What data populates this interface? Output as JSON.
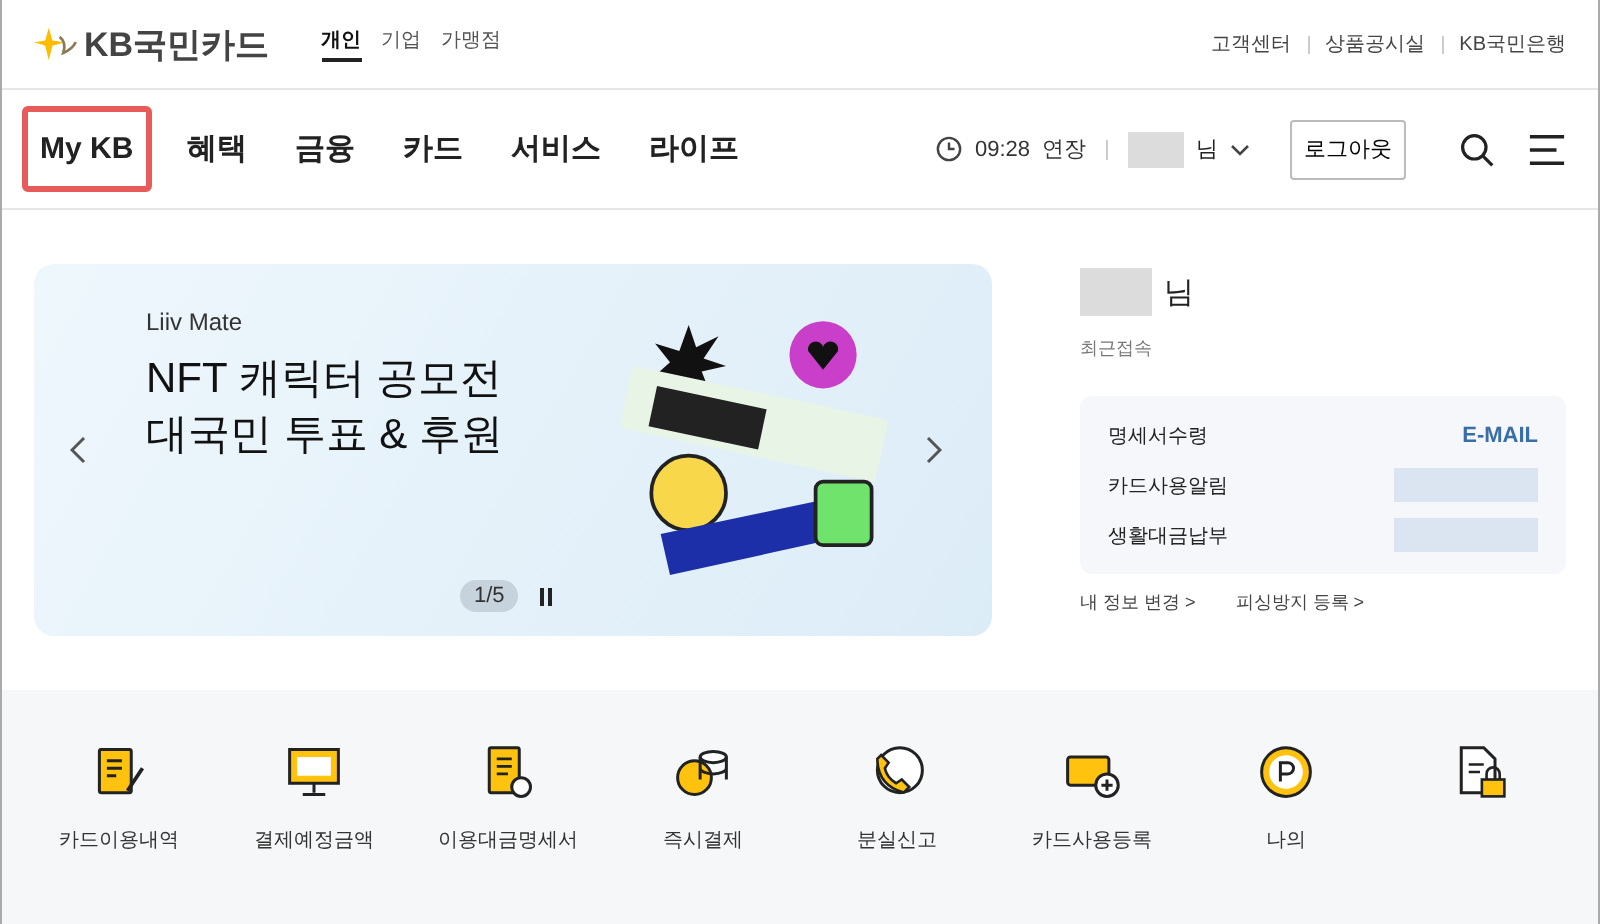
{
  "header": {
    "brand": "KB국민카드",
    "segments": [
      {
        "label": "개인",
        "selected": true
      },
      {
        "label": "기업",
        "selected": false
      },
      {
        "label": "가맹점",
        "selected": false
      }
    ],
    "links": [
      "고객센터",
      "상품공시실",
      "KB국민은행"
    ]
  },
  "nav": {
    "items": [
      {
        "label": "My KB",
        "highlighted": true
      },
      {
        "label": "혜택",
        "highlighted": false
      },
      {
        "label": "금융",
        "highlighted": false
      },
      {
        "label": "카드",
        "highlighted": false
      },
      {
        "label": "서비스",
        "highlighted": false
      },
      {
        "label": "라이프",
        "highlighted": false
      }
    ],
    "time": "09:28",
    "extend": "연장",
    "user_suffix": "님",
    "logout": "로그아웃"
  },
  "banner": {
    "eyebrow": "Liiv Mate",
    "title_lines": [
      "NFT 캐릭터 공모전",
      "대국민 투표 & 후원"
    ],
    "counter": "1/5"
  },
  "profile": {
    "suffix": "님",
    "recent": "최근접속",
    "rows": [
      {
        "label": "명세서수령",
        "value": "E-MAIL"
      },
      {
        "label": "카드사용알림"
      },
      {
        "label": "생활대금납부"
      }
    ],
    "links": [
      "내 정보 변경 >",
      "피싱방지 등록 >"
    ]
  },
  "quick": [
    {
      "kind": "doc-pen",
      "label": "카드이용내역"
    },
    {
      "kind": "monitor",
      "label": "결제예정금액"
    },
    {
      "kind": "doc-check",
      "label": "이용대금명세서"
    },
    {
      "kind": "coins",
      "label": "즉시결제"
    },
    {
      "kind": "phone",
      "label": "분실신고"
    },
    {
      "kind": "card-plus",
      "label": "카드사용등록"
    },
    {
      "kind": "point",
      "label": "나의"
    },
    {
      "kind": "doc-lock"
    }
  ]
}
